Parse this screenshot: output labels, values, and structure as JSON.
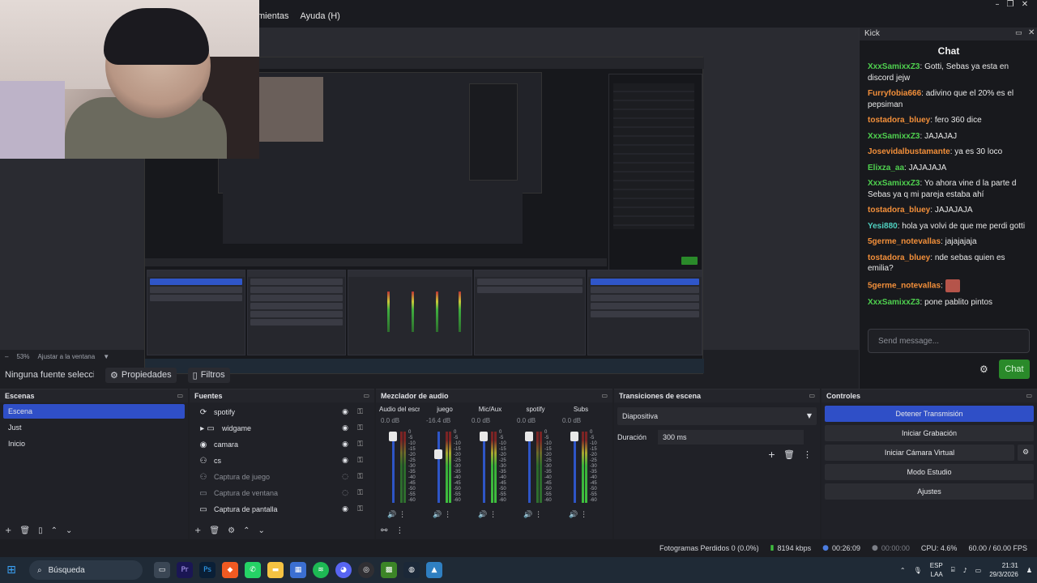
{
  "menubar": {
    "items": [
      "mientas",
      "Ayuda (H)"
    ]
  },
  "window_controls": [
    "–",
    "❐",
    "✕"
  ],
  "preview": {
    "zoom": "53%",
    "fit_label": "Ajustar a la ventana"
  },
  "source_toolbar": {
    "no_source": "Ninguna fuente seleccionada",
    "properties": "Propiedades",
    "filters": "Filtros"
  },
  "chat": {
    "dock_title": "Kick",
    "title": "Chat",
    "messages": [
      {
        "user": "XxxSamixxZ3",
        "text": "Gotti, Sebas ya esta en discord jejw",
        "color": "#4fd14f"
      },
      {
        "user": "Furryfobia666",
        "text": "adivino que el 20% es el pepsiman",
        "color": "#f28f3a"
      },
      {
        "user": "tostadora_bluey",
        "text": "fero 360 dice",
        "color": "#f28f3a"
      },
      {
        "user": "XxxSamixxZ3",
        "text": "JAJAJAJ",
        "color": "#4fd14f"
      },
      {
        "user": "Josevidalbustamante",
        "text": "ya es 30 loco",
        "color": "#f28f3a"
      },
      {
        "user": "Elixza_aa",
        "text": "JAJAJAJA",
        "color": "#4fd14f"
      },
      {
        "user": "XxxSamixxZ3",
        "text": "Yo ahora vine d la parte d Sebas ya q mi pareja estaba ahí",
        "color": "#4fd14f"
      },
      {
        "user": "tostadora_bluey",
        "text": "JAJAJAJA",
        "color": "#f28f3a"
      },
      {
        "user": "Yesi880",
        "text": "hola ya volvi de que me perdi gotti",
        "color": "#4fd1c0"
      },
      {
        "user": "5germe_notevallas",
        "text": "jajajajaja",
        "color": "#f28f3a"
      },
      {
        "user": "tostadora_bluey",
        "text": "nde sebas quien es emilia?",
        "color": "#f28f3a"
      },
      {
        "user": "5germe_notevallas",
        "text": "",
        "color": "#f28f3a"
      },
      {
        "user": "XxxSamixxZ3",
        "text": "pone pablito pintos",
        "color": "#4fd14f"
      }
    ],
    "input_placeholder": "Send message...",
    "send_label": "Chat"
  },
  "scenes": {
    "title": "Escenas",
    "items": [
      "Escena",
      "Just",
      "Inicio"
    ],
    "active": 0
  },
  "sources": {
    "title": "Fuentes",
    "items": [
      {
        "name": "spotify",
        "icon": "⟳",
        "dim": false
      },
      {
        "name": "widgame",
        "icon": "▸ ▭",
        "dim": false
      },
      {
        "name": "camara",
        "icon": "◉",
        "dim": false
      },
      {
        "name": "cs",
        "icon": "⚇",
        "dim": false
      },
      {
        "name": "Captura de juego",
        "icon": "⚇",
        "dim": true
      },
      {
        "name": "Captura de ventana",
        "icon": "▭",
        "dim": true
      },
      {
        "name": "Captura de pantalla",
        "icon": "▭",
        "dim": false
      }
    ]
  },
  "mixer": {
    "title": "Mezclador de audio",
    "channels": [
      {
        "name": "Audio del escritorio",
        "db": "0.0 dB",
        "level": 0.0
      },
      {
        "name": "juego",
        "db": "-16.4 dB",
        "level": -16.4
      },
      {
        "name": "Mic/Aux",
        "db": "0.0 dB",
        "level": 0.0
      },
      {
        "name": "spotify",
        "db": "0.0 dB",
        "level": 0.0
      },
      {
        "name": "Subs",
        "db": "0.0 dB",
        "level": 0.0
      }
    ],
    "scale": [
      "0",
      "-5",
      "-10",
      "-15",
      "-20",
      "-25",
      "-30",
      "-35",
      "-40",
      "-45",
      "-50",
      "-55",
      "-60"
    ]
  },
  "transitions": {
    "title": "Transiciones de escena",
    "selected": "Diapositiva",
    "duration_label": "Duración",
    "duration_value": "300 ms"
  },
  "controls": {
    "title": "Controles",
    "buttons": [
      "Detener Transmisión",
      "Iniciar Grabación",
      "Iniciar Cámara Virtual",
      "Modo Estudio",
      "Ajustes"
    ]
  },
  "status": {
    "dropped_frames": "Fotogramas Perdidos 0 (0.0%)",
    "bitrate": "8194 kbps",
    "stream_time": "00:26:09",
    "record_time": "00:00:00",
    "cpu": "CPU: 4.6%",
    "fps": "60.00 / 60.00 FPS"
  },
  "taskbar": {
    "search_label": "Búsqueda",
    "lang_top": "ESP",
    "lang_bottom": "LAA",
    "time": "21:31",
    "date": "29/3/2026"
  },
  "colors": {
    "accent": "#2f4fc7",
    "chat_send": "#2a8a2a"
  }
}
